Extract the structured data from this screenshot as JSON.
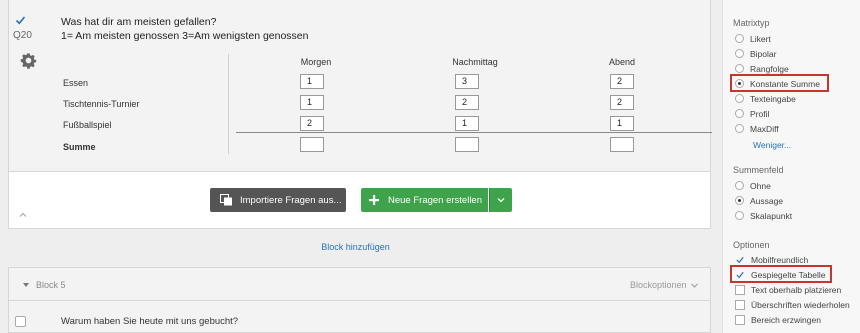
{
  "question": {
    "number": "Q20",
    "text_line1": "Was hat dir am meisten gefallen?",
    "text_line2": "1= Am meisten genossen  3=Am wenigsten genossen",
    "columns": [
      "Morgen",
      "Nachmittag",
      "Abend"
    ],
    "rows": [
      {
        "label": "Essen",
        "values": [
          "1",
          "3",
          "2"
        ]
      },
      {
        "label": "Tischtennis-Turnier",
        "values": [
          "1",
          "2",
          "2"
        ]
      },
      {
        "label": "Fußballspiel",
        "values": [
          "2",
          "1",
          "1"
        ]
      }
    ],
    "sum_label": "Summe",
    "sum_values": [
      "",
      "",
      ""
    ]
  },
  "actions": {
    "import_label": "Importiere Fragen aus...",
    "new_label": "Neue Fragen erstellen"
  },
  "add_block_label": "Block hinzufügen",
  "block5": {
    "title": "Block 5",
    "options_label": "Blockoptionen",
    "question_text": "Warum haben Sie heute mit uns gebucht?"
  },
  "panel": {
    "matrixtyp_title": "Matrixtyp",
    "matrixtyp_options": [
      "Likert",
      "Bipolar",
      "Rangfolge",
      "Konstante Summe",
      "Texteingabe",
      "Profil",
      "MaxDiff"
    ],
    "matrixtyp_selected": "Konstante Summe",
    "less_label": "Weniger...",
    "summenfeld_title": "Summenfeld",
    "summenfeld_options": [
      "Ohne",
      "Aussage",
      "Skalapunkt"
    ],
    "summenfeld_selected": "Aussage",
    "optionen_title": "Optionen",
    "optionen_items": [
      {
        "label": "Mobilfreundlich",
        "checked": true
      },
      {
        "label": "Gespiegelte Tabelle",
        "checked": true
      },
      {
        "label": "Text oberhalb platzieren",
        "checked": false
      },
      {
        "label": "Überschriften wiederholen",
        "checked": false
      },
      {
        "label": "Bereich erzwingen",
        "checked": false
      }
    ]
  },
  "colors": {
    "accent_link": "#2a72b8",
    "new_button": "#3ea34a",
    "import_button": "#555555",
    "highlight": "#c0392b"
  }
}
